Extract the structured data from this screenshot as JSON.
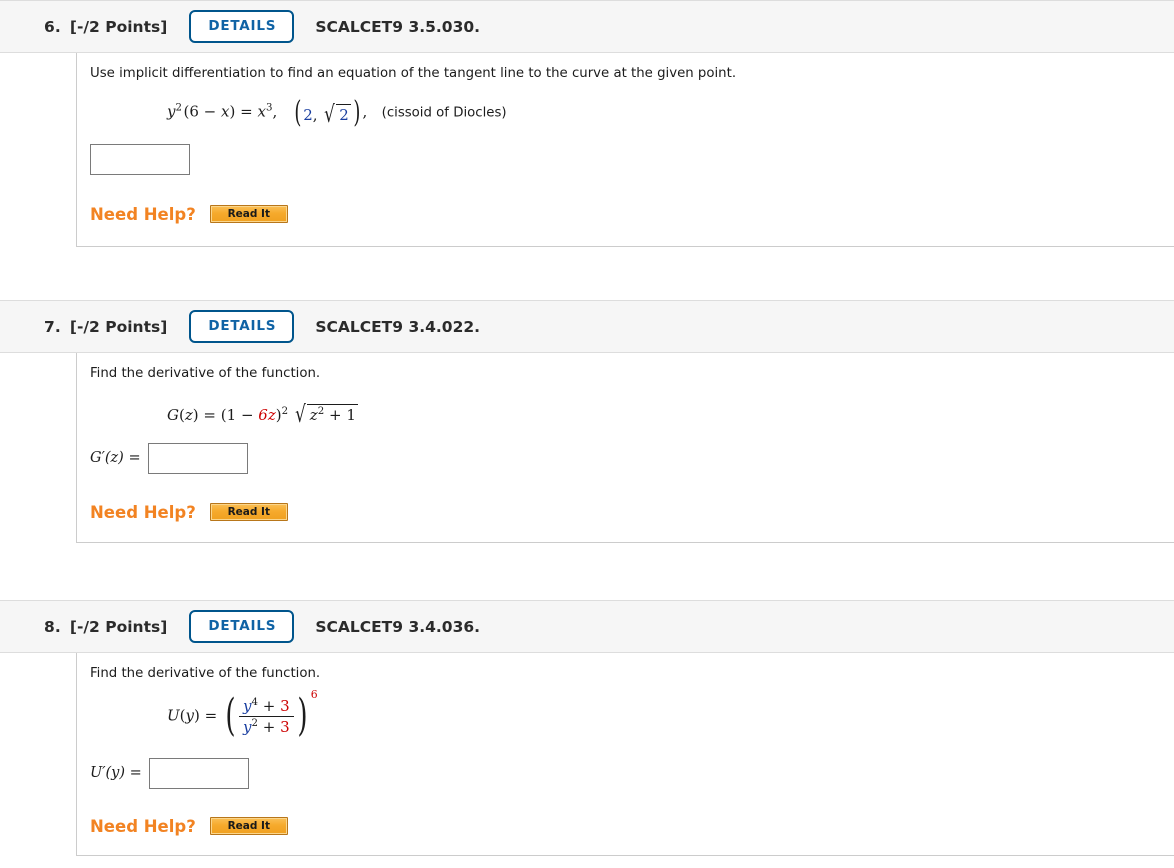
{
  "problems": [
    {
      "number": "6.",
      "points": "[-/2 Points]",
      "details_label": "DETAILS",
      "code": "SCALCET9 3.5.030.",
      "prompt": "Use implicit differentiation to find an equation of the tangent line to the curve at the given point.",
      "equation_plain": "y^2 (6 - x) = x^3,  (2, sqrt(2)),  (cissoid of Diocles)",
      "equation_parts": {
        "y": "y",
        "exp2": "2",
        "lparen": "(",
        "six": "6",
        "minus": "−",
        "x1": "x",
        "rparen": ")",
        "equals": "=",
        "x2": "x",
        "exp3": "3",
        "comma1": ",",
        "pt_two": "2",
        "pt_comma": ",",
        "radical": "√",
        "pt_root": "2",
        "comma2": ",",
        "note": "(cissoid of Diocles)"
      },
      "answer_label": "",
      "answer_value": "",
      "answer_placeholder": "",
      "need_help_label": "Need Help?",
      "read_it_label": "Read It"
    },
    {
      "number": "7.",
      "points": "[-/2 Points]",
      "details_label": "DETAILS",
      "code": "SCALCET9 3.4.022.",
      "prompt": "Find the derivative of the function.",
      "equation_plain": "G(z) = (1 - 6z)^2 sqrt(z^2 + 1)",
      "equation_parts": {
        "G": "G",
        "lp": "(",
        "z1": "z",
        "rp": ")",
        "equals": "=",
        "lparen": "(",
        "one": "1",
        "minus": "−",
        "sixz": "6z",
        "rparen": ")",
        "exp2": "2",
        "radical": "√",
        "z2": "z",
        "exp_sq": "2",
        "plus": "+",
        "one_b": "1"
      },
      "answer_label": "G′(z) =",
      "answer_value": "",
      "answer_placeholder": "",
      "need_help_label": "Need Help?",
      "read_it_label": "Read It"
    },
    {
      "number": "8.",
      "points": "[-/2 Points]",
      "details_label": "DETAILS",
      "code": "SCALCET9 3.4.036.",
      "prompt": "Find the derivative of the function.",
      "equation_plain": "U(y) = ((y^4 + 3)/(y^2 + 3))^6",
      "equation_parts": {
        "U": "U",
        "lp": "(",
        "y1": "y",
        "rp": ")",
        "equals": "=",
        "num_y": "y",
        "num_exp": "4",
        "num_plus": "+",
        "num_three": "3",
        "den_y": "y",
        "den_exp": "2",
        "den_plus": "+",
        "den_three": "3",
        "outer_exp": "6"
      },
      "answer_label": "U′(y) =",
      "answer_value": "",
      "answer_placeholder": "",
      "need_help_label": "Need Help?",
      "read_it_label": "Read It"
    }
  ],
  "colors": {
    "header_bg": "#f6f6f6",
    "details_border": "#00558c",
    "details_text": "#1063a5",
    "need_help_orange": "#f28322",
    "read_it_fill": "#f6aa2c",
    "math_red": "#cc0000",
    "math_blue": "#1a3fa0",
    "input_border": "#7a7a7a"
  }
}
